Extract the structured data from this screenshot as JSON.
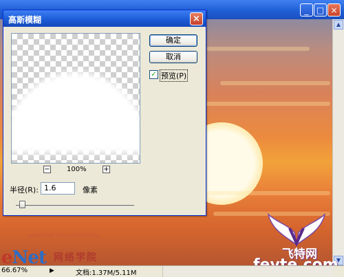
{
  "background_window": {
    "title": "",
    "zoom": "66.67%",
    "doc_info": "文档:1.37M/5.11M"
  },
  "dialog": {
    "title": "高斯模糊",
    "ok_label": "确定",
    "cancel_label": "取消",
    "preview_label": "预览(P)",
    "preview_checked": true,
    "zoom_percent": "100%",
    "radius_label": "半径(R):",
    "radius_value": "1.6",
    "radius_unit": "像素",
    "slider_fraction": 0.05
  },
  "watermarks": {
    "enet_e": "e",
    "enet_rest": "Net",
    "enet_cn": "网络学院",
    "fevte_cn": "飞特网",
    "fevte_url": "fevte.com"
  },
  "icons": [
    "minimize-icon",
    "maximize-icon",
    "close-icon",
    "zoom-out-icon",
    "zoom-in-icon",
    "checkmark-icon"
  ]
}
